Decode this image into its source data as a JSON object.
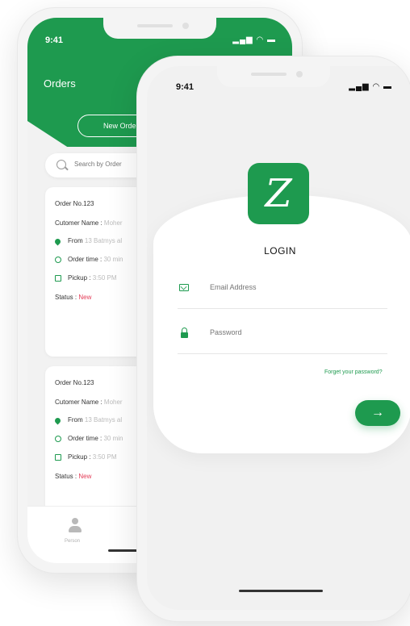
{
  "colors": {
    "brand": "#1e9a4f",
    "status_new": "#e33b56"
  },
  "back_phone": {
    "time": "9:41",
    "status_icons": "▂▄▆ ◠ ▬",
    "title": "Orders",
    "new_orders_label": "New Orders",
    "search_placeholder": "Search by Order",
    "orders": [
      {
        "order_no": "Order No.123",
        "customer_label": "Cutomer Name :",
        "customer_value": "Moher",
        "from_label": "From",
        "from_value": "13 Batmys al",
        "order_time_label": "Order time :",
        "order_time_value": "30 min",
        "pickup_label": "Pickup :",
        "pickup_value": "3:50 PM",
        "status_label": "Status :",
        "status_value": "New"
      },
      {
        "order_no": "Order No.123",
        "customer_label": "Cutomer Name :",
        "customer_value": "Moher",
        "from_label": "From",
        "from_value": "13 Batmys al",
        "order_time_label": "Order time :",
        "order_time_value": "30 min",
        "pickup_label": "Pickup :",
        "pickup_value": "3:50 PM",
        "status_label": "Status :",
        "status_value": "New"
      }
    ],
    "nav_label": "Person",
    "nav_icon": "person-icon"
  },
  "front_phone": {
    "time": "9:41",
    "status_icons": "▂▄▆ ◠ ▬",
    "logo_icon": "brand-logo",
    "logo_glyph": "Z",
    "login_title": "LOGIN",
    "email_placeholder": "Email Address",
    "password_placeholder": "Password",
    "forgot_label": "Forget your password?",
    "submit_glyph": "→"
  }
}
